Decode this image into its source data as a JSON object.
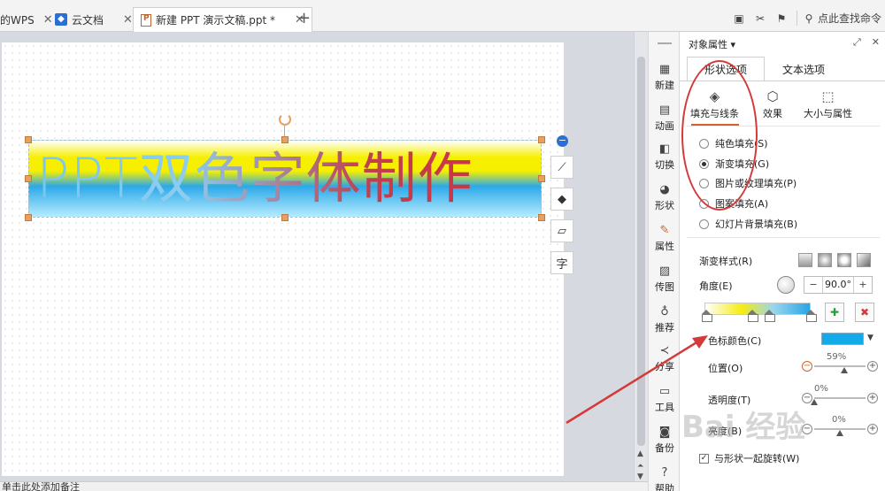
{
  "tabs": {
    "wps_label": "的WPS",
    "cloud_label": "云文档",
    "doc_label": "新建 PPT 演示文稿.ppt *",
    "close": "✕",
    "new_tab": "+"
  },
  "topbar": {
    "search_label": "点此查找命令"
  },
  "slide": {
    "text": "PPT双色字体制作"
  },
  "side_toolbar": {
    "items": [
      "新建",
      "动画",
      "切换",
      "形状",
      "属性",
      "传图",
      "推荐",
      "分享",
      "工具",
      "备份",
      "帮助"
    ]
  },
  "panel": {
    "title": "对象属性 ▾",
    "tab_shape": "形状选项",
    "tab_text": "文本选项",
    "sub_fill": "填充与线条",
    "sub_effect": "效果",
    "sub_size": "大小与属性",
    "fill_options": [
      "纯色填充(S)",
      "渐变填充(G)",
      "图片或纹理填充(P)",
      "图案填充(A)",
      "幻灯片背景填充(B)"
    ],
    "selected_fill": 1,
    "gradient_style_label": "渐变样式(R)",
    "angle_label": "角度(E)",
    "angle_value": "90.0°",
    "stop_color_label": "色标颜色(C)",
    "stop_color": "#12aae8",
    "position_label": "位置(O)",
    "position_value": "59%",
    "position_fraction": 0.59,
    "transparency_label": "透明度(T)",
    "transparency_value": "0%",
    "transparency_fraction": 0.0,
    "brightness_label": "亮度(B)",
    "brightness_value": "0%",
    "brightness_fraction": 0.5,
    "rotate_with_shape": "与形状一起旋转(W)"
  },
  "notes": {
    "placeholder": "单击此处添加备注"
  },
  "watermark": "Bai 经验",
  "colors": {
    "accent": "#d0632b",
    "annotation_red": "#d43a3a",
    "stop_blue": "#12aae8"
  }
}
